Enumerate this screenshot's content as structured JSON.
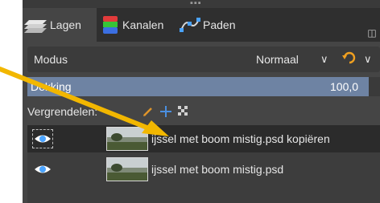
{
  "tabs": [
    {
      "label": "Lagen",
      "icon": "layers-icon",
      "active": true
    },
    {
      "label": "Kanalen",
      "icon": "channels-icon",
      "active": false
    },
    {
      "label": "Paden",
      "icon": "paths-icon",
      "active": false
    }
  ],
  "mode": {
    "label": "Modus",
    "value": "Normaal"
  },
  "opacity": {
    "label": "Dekking",
    "value": "100,0",
    "fraction": 1.0
  },
  "lock": {
    "label": "Vergrendelen:"
  },
  "layers": [
    {
      "name": "ijssel met boom mistig.psd kopiëren",
      "visible": true,
      "selected": true
    },
    {
      "name": "ijssel met boom mistig.psd",
      "visible": true,
      "selected": false
    }
  ],
  "colors": {
    "panel_bg": "#454545",
    "accent": "#6e83a3",
    "arrow": "#f2b700",
    "lock_pen": "#e0952a",
    "lock_move": "#4a8fe0",
    "eye": "#4aa3ff"
  }
}
